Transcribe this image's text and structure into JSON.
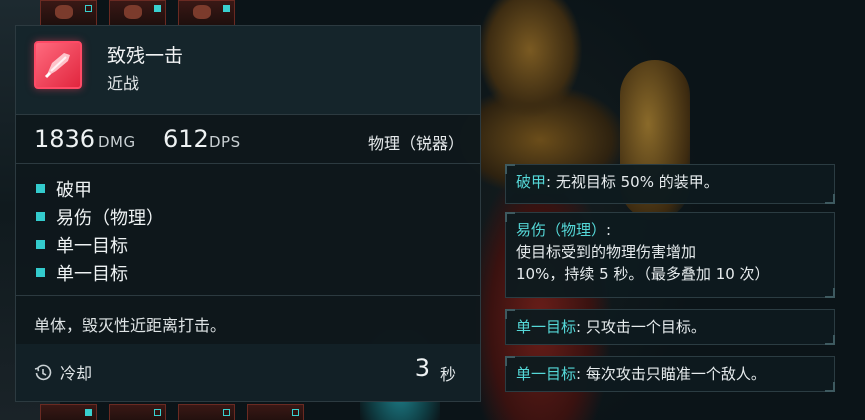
{
  "skill": {
    "name": "致残一击",
    "type": "近战"
  },
  "stats": {
    "damage_value": "1836",
    "damage_unit": "DMG",
    "dps_value": "612",
    "dps_unit": "DPS",
    "damage_type": "物理（锐器）"
  },
  "tags": [
    "破甲",
    "易伤（物理）",
    "单一目标",
    "单一目标"
  ],
  "description": "单体，毁灭性近距离打击。",
  "cooldown": {
    "label": "冷却",
    "value": "3",
    "unit": "秒"
  },
  "keywords": [
    {
      "term": "破甲",
      "text": ": 无视目标 50% 的装甲。"
    },
    {
      "term": "易伤（物理）",
      "text": ":",
      "line2": "使目标受到的物理伤害增加",
      "line3": "10%，持续 5 秒。（最多叠加 10 次）"
    },
    {
      "term": "单一目标",
      "text": ": 只攻击一个目标。"
    },
    {
      "term": "单一目标",
      "text": ": 每次攻击只瞄准一个敌人。"
    }
  ],
  "colors": {
    "accent_cyan": "#33cbcd",
    "icon_red": "#e1263e",
    "panel_bg": "#0e181c"
  },
  "icons": {
    "skill": "slash-blade-icon",
    "cooldown": "cooldown-timer-icon"
  }
}
